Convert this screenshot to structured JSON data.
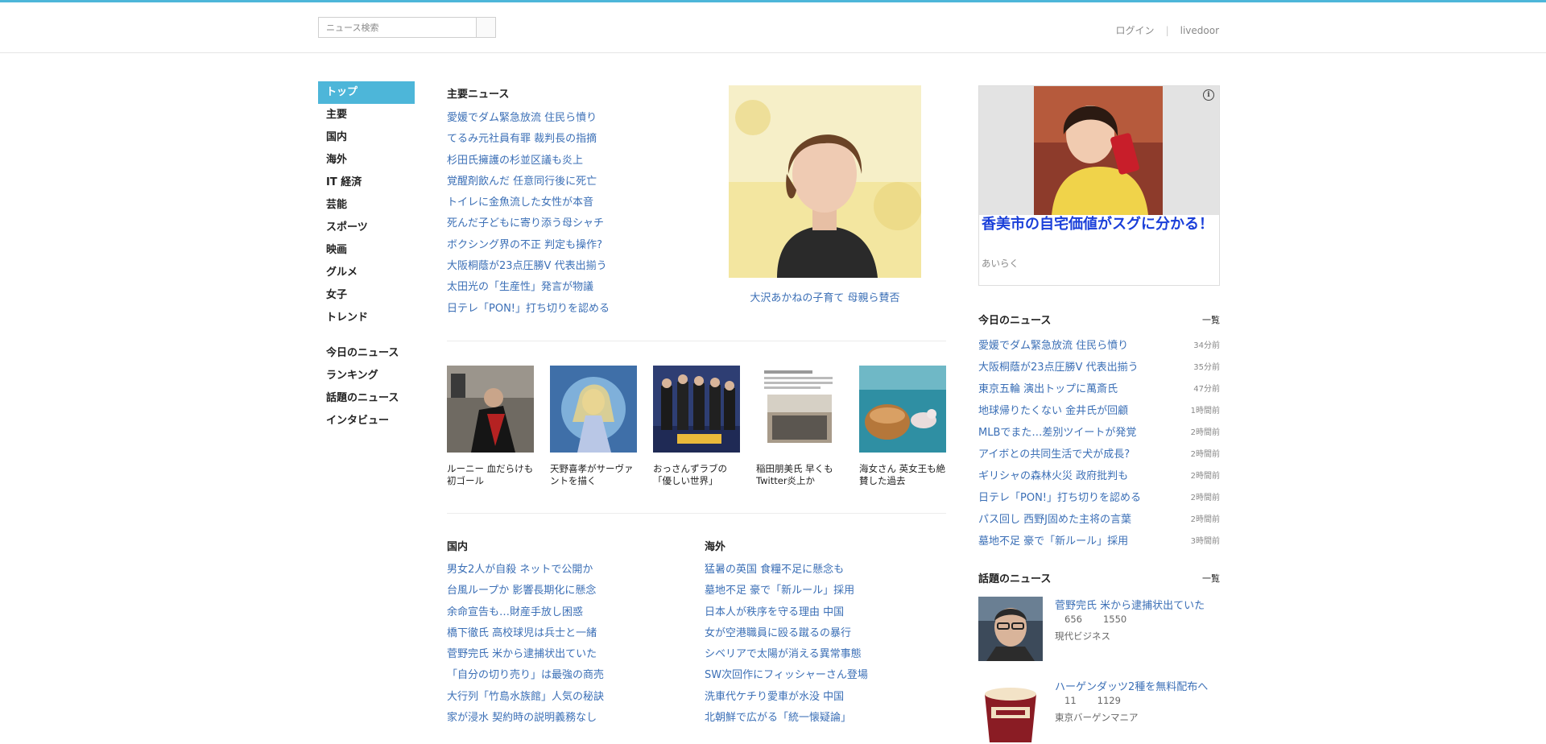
{
  "header": {
    "search_placeholder": "ニュース検索",
    "login": "ログイン",
    "brand": "livedoor"
  },
  "nav": {
    "items": [
      "トップ",
      "主要",
      "国内",
      "海外",
      "IT 経済",
      "芸能",
      "スポーツ",
      "映画",
      "グルメ",
      "女子",
      "トレンド"
    ],
    "extra": [
      "今日のニュース",
      "ランキング",
      "話題のニュース",
      "インタビュー"
    ],
    "active": "トップ"
  },
  "main_news": {
    "title": "主要ニュース",
    "items": [
      "愛媛でダム緊急放流 住民ら憤り",
      "てるみ元社員有罪 裁判長の指摘",
      "杉田氏擁護の杉並区議も炎上",
      "覚醒剤飲んだ 任意同行後に死亡",
      "トイレに金魚流した女性が本音",
      "死んだ子どもに寄り添う母シャチ",
      "ボクシング界の不正 判定も操作?",
      "大阪桐蔭が23点圧勝V 代表出揃う",
      "太田光の「生産性」発言が物議",
      "日テレ「PON!」打ち切りを認める"
    ],
    "featured_caption": "大沢あかねの子育て 母親ら賛否"
  },
  "thumbnails": [
    "ルーニー 血だらけも初ゴール",
    "天野喜孝がサーヴァントを描く",
    "おっさんずラブの「優しい世界」",
    "稲田朋美氏 早くもTwitter炎上か",
    "海女さん 英女王も絶賛した過去"
  ],
  "domestic": {
    "title": "国内",
    "items": [
      "男女2人が自殺 ネットで公開か",
      "台風ループか 影響長期化に懸念",
      "余命宣告も…財産手放し困惑",
      "橋下徹氏 高校球児は兵士と一緒",
      "菅野完氏 米から逮捕状出ていた",
      "「自分の切り売り」は最強の商売",
      "大行列「竹島水族館」人気の秘訣",
      "家が浸水 契約時の説明義務なし"
    ]
  },
  "overseas": {
    "title": "海外",
    "items": [
      "猛暑の英国 食糧不足に懸念も",
      "墓地不足 豪で「新ルール」採用",
      "日本人が秩序を守る理由 中国",
      "女が空港職員に殴る蹴るの暴行",
      "シベリアで太陽が消える異常事態",
      "SW次回作にフィッシャーさん登場",
      "洗車代ケチり愛車が水没 中国",
      "北朝鮮で広がる「統一懐疑論」"
    ]
  },
  "ad": {
    "title": "香美市の自宅価値がスグに分かる！",
    "sponsor": "あいらく",
    "info_icon": "i"
  },
  "today": {
    "title": "今日のニュース",
    "more": "一覧",
    "items": [
      {
        "text": "愛媛でダム緊急放流 住民ら憤り",
        "time": "34分前"
      },
      {
        "text": "大阪桐蔭が23点圧勝V 代表出揃う",
        "time": "35分前"
      },
      {
        "text": "東京五輪 演出トップに萬斎氏",
        "time": "47分前"
      },
      {
        "text": "地球帰りたくない 金井氏が回顧",
        "time": "1時間前"
      },
      {
        "text": "MLBでまた…差別ツイートが発覚",
        "time": "2時間前"
      },
      {
        "text": "アイボとの共同生活で犬が成長?",
        "time": "2時間前"
      },
      {
        "text": "ギリシャの森林火災 政府批判も",
        "time": "2時間前"
      },
      {
        "text": "日テレ「PON!」打ち切りを認める",
        "time": "2時間前"
      },
      {
        "text": "パス回し 西野J固めた主将の言葉",
        "time": "2時間前"
      },
      {
        "text": "墓地不足 豪で「新ルール」採用",
        "time": "3時間前"
      }
    ]
  },
  "topics": {
    "title": "話題のニュース",
    "more": "一覧",
    "items": [
      {
        "title": "菅野完氏 米から逮捕状出ていた",
        "count1": "656",
        "count2": "1550",
        "source": "現代ビジネス"
      },
      {
        "title": "ハーゲンダッツ2種を無料配布へ",
        "count1": "11",
        "count2": "1129",
        "source": "東京バーゲンマニア"
      }
    ]
  },
  "colors": {
    "accent": "#4db6d9",
    "link": "#3b6fb6",
    "ad_title": "#1a3fd9"
  }
}
